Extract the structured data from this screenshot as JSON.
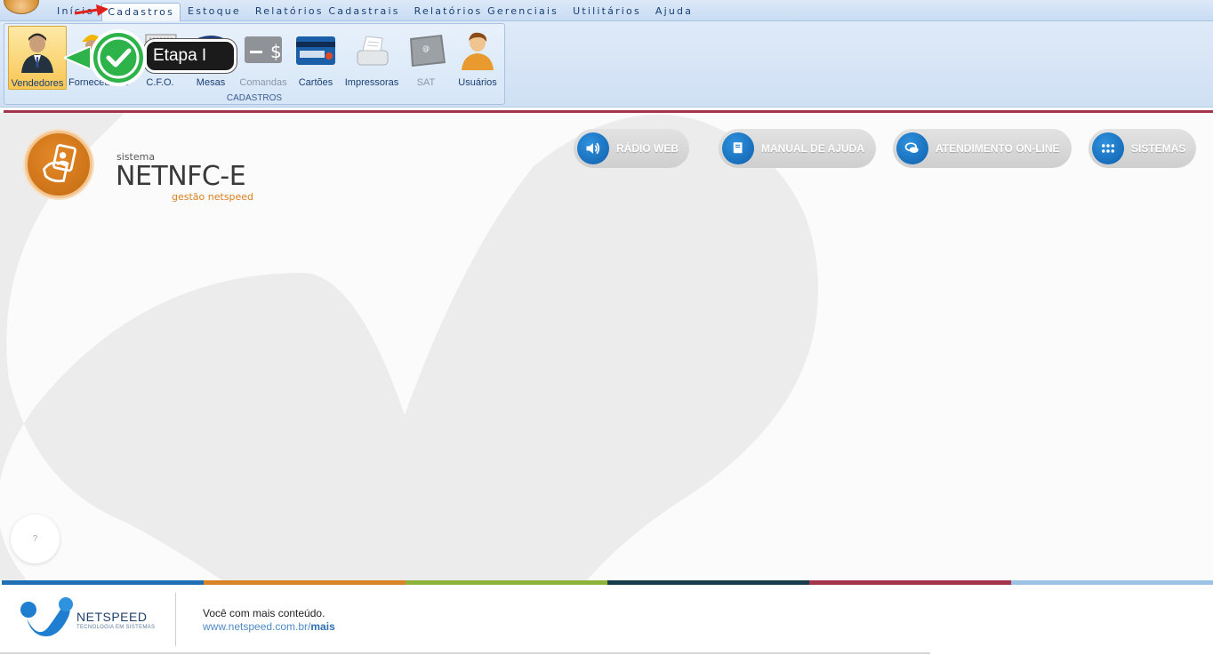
{
  "menu": {
    "items": [
      "Início",
      "Cadastros",
      "Estoque",
      "Relatórios Cadastrais",
      "Relatórios Gerenciais",
      "Utilitários",
      "Ajuda"
    ],
    "active": "Cadastros"
  },
  "ribbon": {
    "group_label": "CADASTROS",
    "buttons": [
      {
        "label": "Vendedores",
        "icon": "salesman-icon"
      },
      {
        "label": "Fornecedores",
        "icon": "supplier-hardhat-icon"
      },
      {
        "label": "C.F.O.",
        "icon": "cfo-icon"
      },
      {
        "label": "Mesas",
        "icon": "table-icon"
      },
      {
        "label": "Comandas",
        "icon": "order-dollar-icon"
      },
      {
        "label": "Cartões",
        "icon": "credit-card-icon"
      },
      {
        "label": "Impressoras",
        "icon": "printer-icon"
      },
      {
        "label": "SAT",
        "icon": "sat-device-icon"
      },
      {
        "label": "Usuários",
        "icon": "user-icon"
      }
    ]
  },
  "callout": {
    "text": "Etapa I"
  },
  "brand": {
    "label": "sistema",
    "name": "NETNFC-E",
    "subtitle": "gestão netspeed"
  },
  "links": [
    {
      "label": "RÁDIO WEB",
      "icon": "speaker-icon"
    },
    {
      "label": "MANUAL DE AJUDA",
      "icon": "book-icon"
    },
    {
      "label": "ATENDIMENTO ON-LINE",
      "icon": "chat-icon"
    },
    {
      "label": "SISTEMAS",
      "icon": "apps-grid-icon"
    }
  ],
  "help": {
    "text": "?"
  },
  "footer": {
    "company": "NETSPEED",
    "tagline": "TECNOLOGIA EM SISTEMAS",
    "text": "Você com mais conteúdo.",
    "link_prefix": "www.netspeed.com.br/",
    "link_bold": "mais"
  },
  "colors": {
    "band": [
      "#1f6fb4",
      "#d88326",
      "#8fb23a",
      "#173d4c",
      "#a3344c",
      "#9cc3e6"
    ],
    "accent": "#d9801e",
    "link_pill": "#1f7ed0"
  }
}
